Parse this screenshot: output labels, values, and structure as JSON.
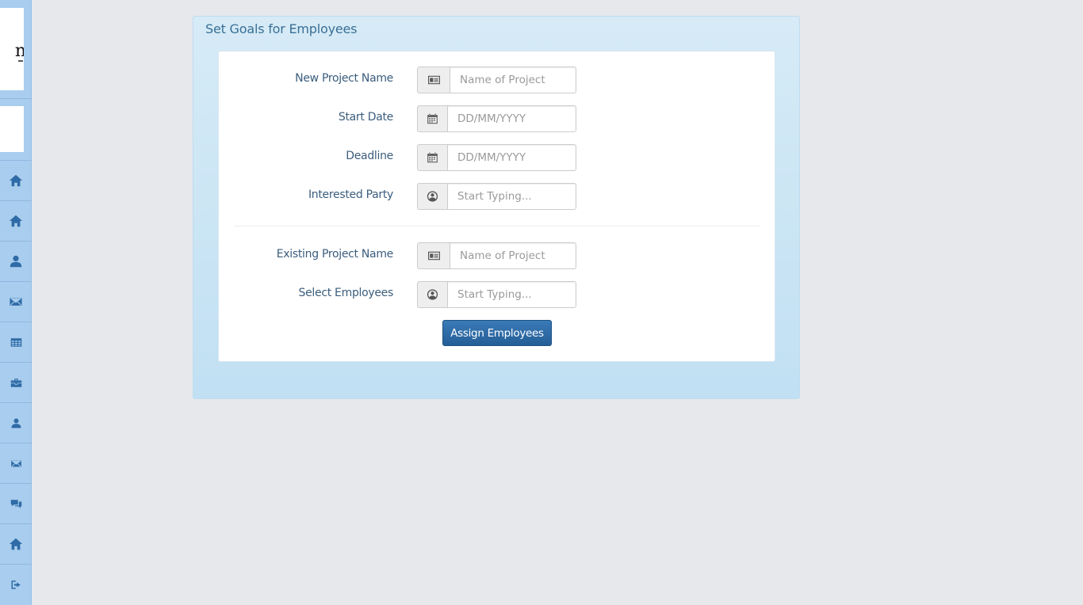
{
  "sidebar": {
    "logo_glyph": "n",
    "nav": [
      {
        "icon": "home-icon"
      },
      {
        "icon": "home-icon"
      },
      {
        "icon": "user-icon"
      },
      {
        "icon": "envelope-icon"
      },
      {
        "icon": "table-icon"
      },
      {
        "icon": "briefcase-icon"
      },
      {
        "icon": "user-icon"
      },
      {
        "icon": "envelope-icon"
      },
      {
        "icon": "comments-icon"
      },
      {
        "icon": "home-icon"
      },
      {
        "icon": "sign-out-icon"
      }
    ]
  },
  "panel": {
    "title": "Set Goals for Employees"
  },
  "form": {
    "new_project": {
      "label": "New Project Name",
      "placeholder": "Name of Project",
      "icon": "id-card-icon"
    },
    "start_date": {
      "label": "Start Date",
      "placeholder": "DD/MM/YYYY",
      "icon": "calendar-icon"
    },
    "deadline": {
      "label": "Deadline",
      "placeholder": "DD/MM/YYYY",
      "icon": "calendar-icon"
    },
    "interested_party": {
      "label": "Interested Party",
      "placeholder": "Start Typing...",
      "icon": "user-circle-icon"
    },
    "existing_project": {
      "label": "Existing Project Name",
      "placeholder": "Name of Project",
      "icon": "id-card-icon"
    },
    "select_employees": {
      "label": "Select Employees",
      "placeholder": "Start Typing...",
      "icon": "user-circle-icon"
    },
    "submit_label": "Assign Employees"
  },
  "colors": {
    "sidebar_bg": "#a9cdee",
    "nav_icon": "#2f6ba6",
    "panel_title": "#3a6f96",
    "label": "#3b5d7d",
    "button": "#2d6ca8",
    "page_bg": "#e6e8ec"
  }
}
